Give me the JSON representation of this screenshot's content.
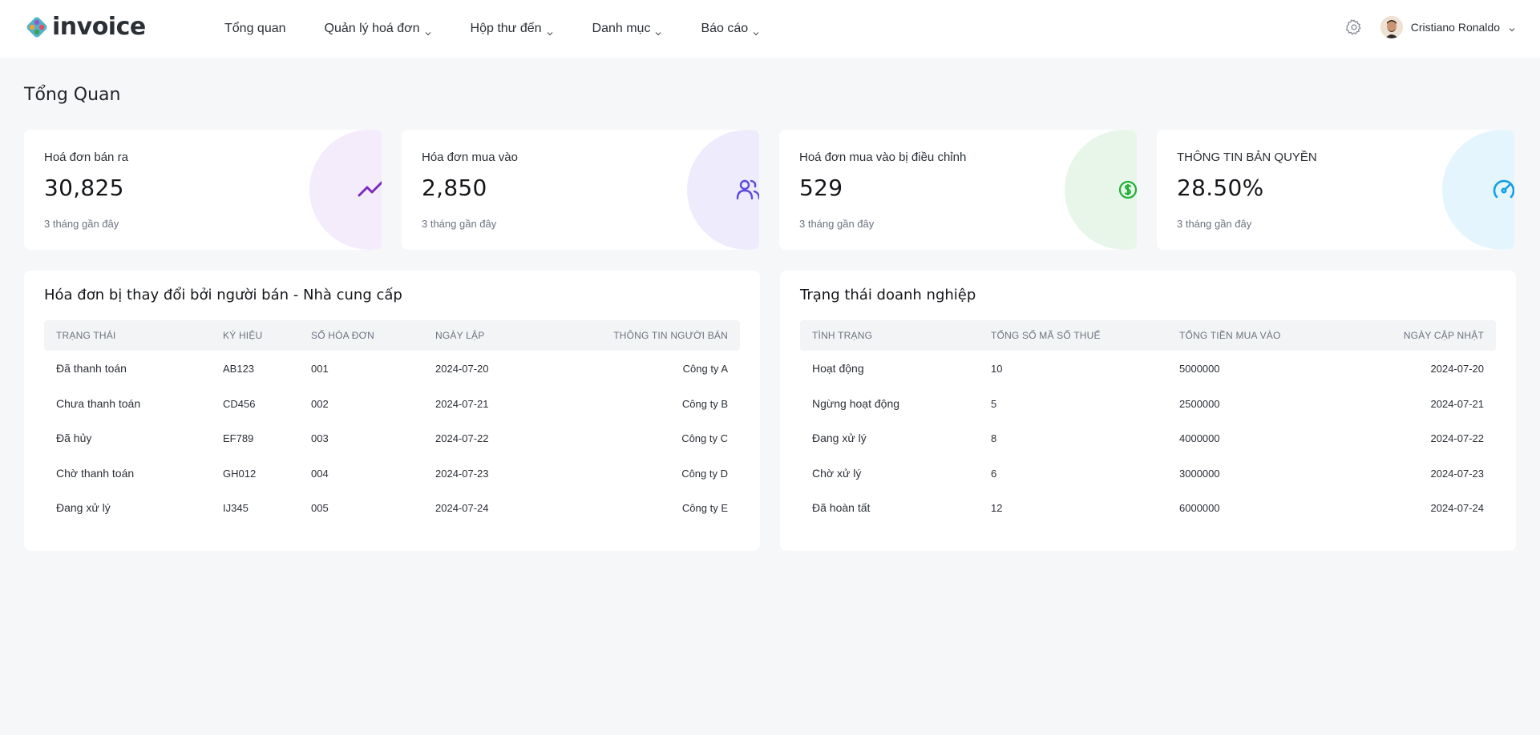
{
  "brand": {
    "name": "invoice"
  },
  "nav": [
    {
      "label": "Tổng quan",
      "has_dropdown": false
    },
    {
      "label": "Quản lý hoá đơn",
      "has_dropdown": true
    },
    {
      "label": "Hộp thư đến",
      "has_dropdown": true
    },
    {
      "label": "Danh mục",
      "has_dropdown": true
    },
    {
      "label": "Báo cáo",
      "has_dropdown": true
    }
  ],
  "user": {
    "name": "Cristiano Ronaldo"
  },
  "page": {
    "title": "Tổng Quan"
  },
  "stats": [
    {
      "label": "Hoá đơn bán ra",
      "value": "30,825",
      "sub": "3 tháng gần đây",
      "icon": "trending-up-icon",
      "color": "#7b2cbf",
      "bg": "#f4ebfb"
    },
    {
      "label": "Hóa đơn mua vào",
      "value": "2,850",
      "sub": "3 tháng gần đây",
      "icon": "users-icon",
      "color": "#5b4bdb",
      "bg": "#eeebfd"
    },
    {
      "label": "Hoá đơn mua vào bị điều chỉnh",
      "value": "529",
      "sub": "3 tháng gần đây",
      "icon": "dollar-circle-icon",
      "color": "#1fb135",
      "bg": "#e8f6ea"
    },
    {
      "label": "THÔNG TIN BẢN QUYỀN",
      "value": "28.50%",
      "sub": "3 tháng gần đây",
      "icon": "gauge-icon",
      "color": "#139ee8",
      "bg": "#e5f5fd"
    }
  ],
  "sellerTable": {
    "title": "Hóa đơn bị thay đổi bởi người bán - Nhà cung cấp",
    "columns": [
      "TRẠNG THÁI",
      "KÝ HIỆU",
      "SỐ HÓA ĐƠN",
      "NGÀY LẬP",
      "THÔNG TIN NGƯỜI BÁN"
    ],
    "rows": [
      [
        "Đã thanh toán",
        "AB123",
        "001",
        "2024-07-20",
        "Công ty A"
      ],
      [
        "Chưa thanh toán",
        "CD456",
        "002",
        "2024-07-21",
        "Công ty B"
      ],
      [
        "Đã hủy",
        "EF789",
        "003",
        "2024-07-22",
        "Công ty C"
      ],
      [
        "Chờ thanh toán",
        "GH012",
        "004",
        "2024-07-23",
        "Công ty D"
      ],
      [
        "Đang xử lý",
        "IJ345",
        "005",
        "2024-07-24",
        "Công ty E"
      ]
    ]
  },
  "statusTable": {
    "title": "Trạng thái doanh nghiệp",
    "columns": [
      "TÌNH TRẠNG",
      "TỔNG SỐ MÃ SỐ THUẾ",
      "TỔNG TIỀN MUA VÀO",
      "NGÀY CẬP NHẬT"
    ],
    "rows": [
      [
        "Hoạt động",
        "10",
        "5000000",
        "2024-07-20"
      ],
      [
        "Ngừng hoạt động",
        "5",
        "2500000",
        "2024-07-21"
      ],
      [
        "Đang xử lý",
        "8",
        "4000000",
        "2024-07-22"
      ],
      [
        "Chờ xử lý",
        "6",
        "3000000",
        "2024-07-23"
      ],
      [
        "Đã hoàn tất",
        "12",
        "6000000",
        "2024-07-24"
      ]
    ]
  }
}
